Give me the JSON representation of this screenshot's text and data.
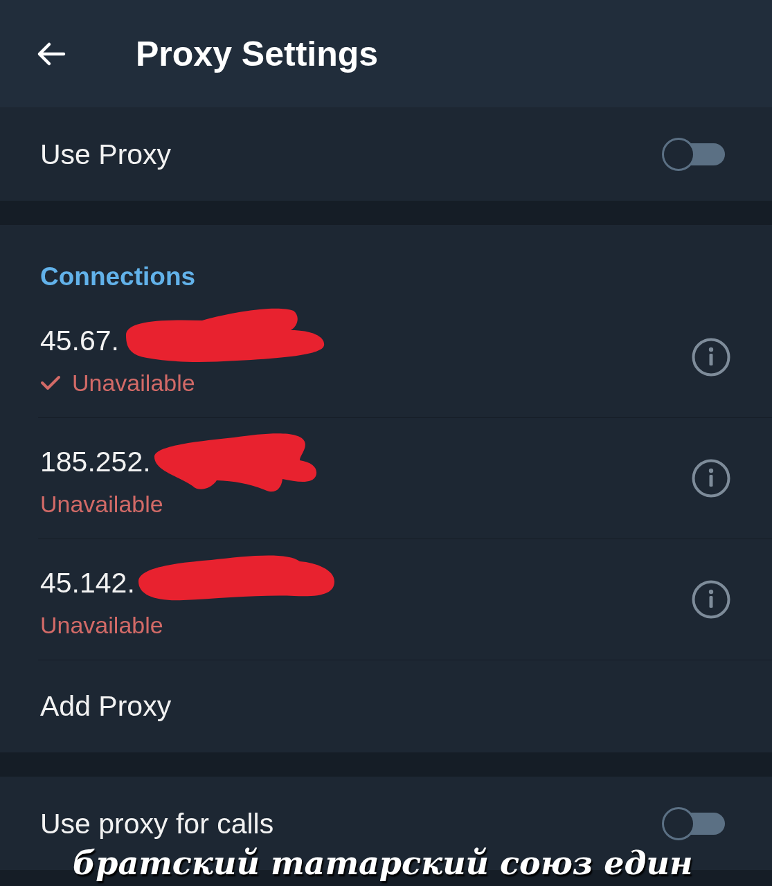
{
  "header": {
    "title": "Proxy Settings"
  },
  "use_proxy": {
    "label": "Use Proxy",
    "on": false
  },
  "connections": {
    "title": "Connections",
    "items": [
      {
        "address": "45.67.",
        "status": "Unavailable",
        "selected": true,
        "redacted": true
      },
      {
        "address": "185.252.",
        "status": "Unavailable",
        "selected": false,
        "redacted": true
      },
      {
        "address": "45.142.",
        "status": "Unavailable",
        "selected": false,
        "redacted": true
      }
    ]
  },
  "add_proxy": {
    "label": "Add Proxy"
  },
  "calls_proxy": {
    "label": "Use proxy for calls",
    "on": false
  },
  "caption": "братский татарский союз един"
}
